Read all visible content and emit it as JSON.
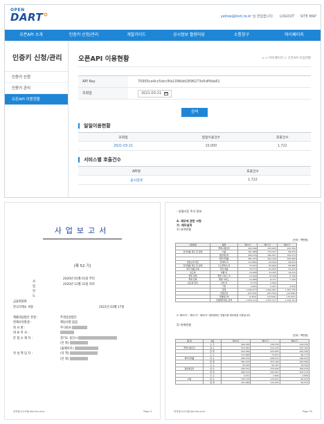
{
  "header": {
    "logo_open": "OPEN",
    "logo_dart": "DART",
    "user_id": "yellow@kisti.re.kr",
    "user_suffix": " 님 반갑습니다.",
    "logout": "LOGOUT",
    "sitemap": "SITE MAP"
  },
  "gnb": [
    "오픈API 소개",
    "인증키 신청/관리",
    "개발가이드",
    "공시정보 활용마당",
    "소통창구",
    "마이페이지"
  ],
  "sidebar": {
    "title": "인증키 신청/관리",
    "items": [
      {
        "label": "인증키 신청",
        "active": false
      },
      {
        "label": "인증키 관리",
        "active": false
      },
      {
        "label": "오픈API 이용현황",
        "active": true
      }
    ]
  },
  "main": {
    "title": "오픈API 이용현황",
    "breadcrumb": "⌂  >  마이페이지  >  오픈API 이용현황",
    "form": {
      "api_key_label": "API Key",
      "api_key_value": "70905ca4cc5dcc9fa1096dd2896273e5df9da61",
      "date_label": "조회일",
      "date_value": "2021-03-21"
    },
    "search_button": "검색",
    "daily_section": "일일이용현황",
    "daily_headers": [
      "조회일",
      "일일이용건수",
      "호출건수"
    ],
    "daily_rows": [
      [
        "2021-03-21",
        "10,000",
        "1,722"
      ]
    ],
    "service_section": "서비스별 호출건수",
    "service_headers": [
      "API명",
      "호출건수"
    ],
    "service_rows": [
      [
        "공시검색",
        "1,722"
      ]
    ]
  },
  "doc_left": {
    "title": "사업보고서",
    "term": "(제 52 기)",
    "period_label": "사업연도",
    "period_from": "2020년 01월 01일   부터",
    "period_to": "2020년 12월 31일   까지",
    "to_label": "금융위원회",
    "exchange": "한국거래소 귀중",
    "submit_date": "2021년   03월   17일",
    "lines": [
      {
        "k": "제출대상법인 유형 :",
        "v": "주권상장법인"
      },
      {
        "k": "면제사유발생 :",
        "v": "해당사항 없음"
      },
      {
        "k": "회 사 명 :",
        "v": "주식회사"
      },
      {
        "k": "대 표 이 사 :",
        "v": ""
      },
      {
        "k": "본 점 소 재 지 :",
        "v": "경기도 용인시"
      },
      {
        "k": "",
        "v": "(전 화)"
      },
      {
        "k": "",
        "v": "(홈페이지)"
      },
      {
        "k": "작 성 책 임 자 :",
        "v": "(직 책)"
      },
      {
        "k": "",
        "v": "(전 화)"
      }
    ],
    "footer_left": "전자공시시스템 dart.fss.or.kr",
    "footer_right": "Page 4"
  },
  "doc_right": {
    "heading1": "- 연결기준 주가 정보",
    "heading2": "4. 재무에 관한 사항",
    "heading3": "가. 재무실적",
    "heading4": "1) 요약연결",
    "unit1": "(단위 : 백만원)",
    "t1_headers": [
      "사업부문",
      "품목",
      "제52기",
      "제51기",
      "제50기"
    ],
    "t1_rows": [
      [
        "",
        "플래시메모리",
        "416,366",
        "433,605",
        "425,396"
      ],
      [
        "전자부품 제조 및 판매",
        "D램",
        "161,988",
        "174,227",
        "84,979"
      ],
      [
        "",
        "일반메모리",
        "280,576",
        "290,957",
        "303,274"
      ],
      [
        "",
        "패키지제품",
        "381,976",
        "303,184",
        "293,589"
      ],
      [
        "정밀소재 제조",
        "전해액 외",
        "119,864",
        "64,099",
        "66,823"
      ],
      [
        "전자제품 제조 및 판매",
        "디스플레이 외",
        "75,625",
        "83,669",
        "83,686"
      ],
      [
        "화학 제품 판매",
        "석유 제품",
        "76,373",
        "64,994",
        "53,423"
      ],
      [
        "반도체",
        "부품 외",
        "19,908",
        "13,453",
        "19,034"
      ],
      [
        "물류 판매",
        "물류 서비스 외",
        "12,026",
        "13,128",
        "8,796"
      ],
      [
        "물류 판매",
        "물류 서비스",
        "12,968",
        "8,737",
        "7,199"
      ],
      [
        "반도체 장비",
        "장비 외",
        "6,715",
        "2,904",
        ""
      ],
      [
        "",
        "기타",
        "4,041",
        "5,427",
        "4,559"
      ],
      [
        "",
        "합계",
        "1,549,073",
        "1,460,901",
        "1,397,750"
      ],
      [
        "",
        "연결조정",
        "(45,702)",
        "(59,750)",
        "(22,809)"
      ],
      [
        "",
        "연결매출액",
        "(2,875)",
        "(10,592)",
        "(15,957)"
      ],
      [
        "",
        "연결재무제표 합계",
        "1,504,111",
        "1,357,117",
        "1,316,791"
      ]
    ],
    "note": "※ '제52기', '제51기', '제50기' 재무정보는 연결기준 재무제표 기준입니다.",
    "heading5": "2) 자체연결",
    "unit2": "(단위 : 백만원)",
    "t2_headers": [
      "품 목",
      "구분",
      "제52기",
      "제51기",
      "제50기"
    ],
    "t2_rows": [
      [
        "",
        "수 출",
        "406,336",
        "118,376",
        "118,316"
      ],
      [
        "플래시메모리",
        "내 수",
        "312,090",
        "314,125",
        "307,183"
      ],
      [
        "",
        "합 계",
        "416,366",
        "433,605",
        "425,396"
      ],
      [
        "",
        "수 출",
        "137,668",
        "74,613",
        "66,773"
      ],
      [
        "패키지제품",
        "내 수",
        "280,576",
        "228,572",
        "196,933"
      ],
      [
        "",
        "합 계",
        "381,976",
        "303,184",
        "293,589"
      ],
      [
        "",
        "수 출",
        "25,916",
        "50,307",
        "18,342"
      ],
      [
        "일반메모리",
        "내 수",
        "299,761",
        "279,630",
        "309,978"
      ],
      [
        "",
        "합 계",
        "280,576",
        "290,957",
        "303,274"
      ],
      [
        "",
        "수 출",
        "2,211",
        "1,692",
        "2,000"
      ],
      [
        "D램",
        "내 수",
        "159,718",
        "115,615",
        "82,979"
      ],
      [
        "",
        "합 계",
        "161,988",
        "115,297",
        "84,979"
      ]
    ],
    "footer_left": "전자공시시스템 dart.fss.or.kr",
    "footer_right": "Page 33"
  }
}
